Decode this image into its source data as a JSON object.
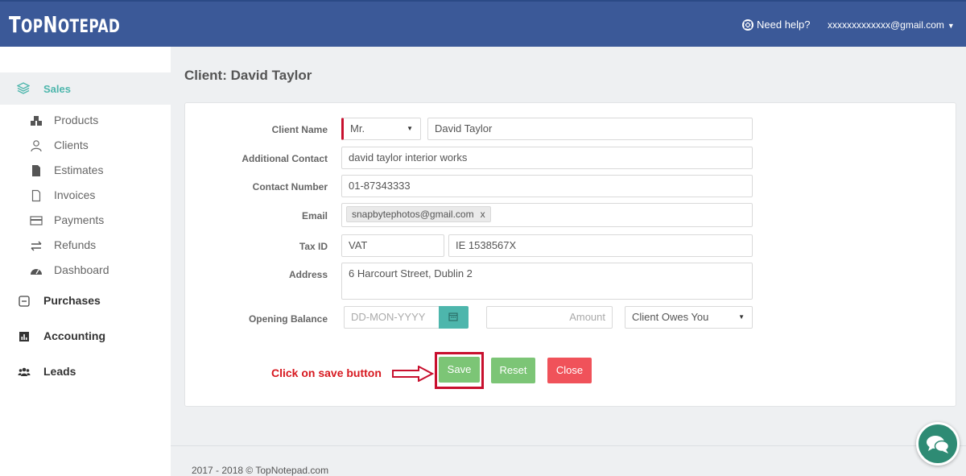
{
  "header": {
    "logo_text": "TopNotepad",
    "logo_first": "T",
    "logo_mid": "OP",
    "logo_n": "N",
    "logo_rest": "OTEPAD",
    "help_label": "Need help?",
    "user_email": "xxxxxxxxxxxxx@gmail.com",
    "brand_color": "#3b5998"
  },
  "sidebar": {
    "active_section": "Sales",
    "sales_items": [
      {
        "label": "Products",
        "icon": "cubes-icon"
      },
      {
        "label": "Clients",
        "icon": "user-outline-icon"
      },
      {
        "label": "Estimates",
        "icon": "file-icon"
      },
      {
        "label": "Invoices",
        "icon": "file-outline-icon"
      },
      {
        "label": "Payments",
        "icon": "credit-card-icon"
      },
      {
        "label": "Refunds",
        "icon": "exchange-icon"
      },
      {
        "label": "Dashboard",
        "icon": "tachometer-icon"
      }
    ],
    "sections": [
      {
        "label": "Purchases",
        "icon": "minus-square-icon"
      },
      {
        "label": "Accounting",
        "icon": "bar-chart-icon"
      },
      {
        "label": "Leads",
        "icon": "users-icon"
      }
    ],
    "accent_color": "#4db6ac"
  },
  "main": {
    "title": "Client: David Taylor",
    "form": {
      "client_name_label": "Client Name",
      "salutation": "Mr.",
      "client_name": "David Taylor",
      "additional_contact_label": "Additional Contact",
      "additional_contact": "david taylor interior works",
      "contact_number_label": "Contact Number",
      "contact_number": "01-87343333",
      "email_label": "Email",
      "email_tag": "snapbytephotos@gmail.com",
      "email_tag_remove": "x",
      "tax_id_label": "Tax ID",
      "tax_type": "VAT",
      "tax_number": "IE 1538567X",
      "address_label": "Address",
      "address": "6 Harcourt Street, Dublin 2",
      "opening_balance_label": "Opening Balance",
      "date_placeholder": "DD-MON-YYYY",
      "amount_placeholder": "Amount",
      "balance_direction": "Client Owes You"
    },
    "buttons": {
      "save": "Save",
      "reset": "Reset",
      "close": "Close"
    },
    "annotation": "Click on save button"
  },
  "footer": {
    "text": "2017 - 2018 © TopNotepad.com"
  }
}
